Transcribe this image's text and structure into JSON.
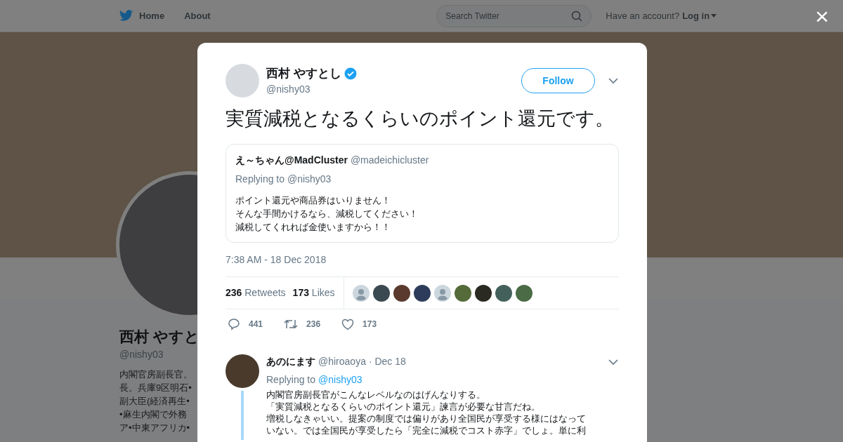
{
  "nav": {
    "links": [
      "Home",
      "About"
    ],
    "search": {
      "placeholder": "Search Twitter"
    },
    "account_prompt": "Have an account?",
    "login": "Log in",
    "close": "×"
  },
  "profile": {
    "name": "西村 やすと",
    "handle": "@nishy03",
    "bio_lines": [
      "内閣官房副長官。",
      "長。兵庫9区明石•",
      "副大臣(経済再生•",
      "•麻生内閣で外務",
      "ア•中東アフリカ•"
    ]
  },
  "tweet": {
    "author": {
      "name": "西村 やすとし",
      "handle": "@nishy03",
      "verified": true
    },
    "follow": "Follow",
    "text": "実質減税となるくらいのポイント還元です。",
    "quoted": {
      "name": "え～ちゃん@MadCluster",
      "handle": "@madeichicluster",
      "replying": "Replying to @nishy03",
      "lines": [
        "ポイント還元や商品券はいりません！",
        "そんな手間かけるなら、減税してください！",
        "減税してくれれば金使いますから！！"
      ]
    },
    "timestamp": "7:38 AM - 18 Dec 2018",
    "stats": [
      {
        "count": "236",
        "label": "Retweets"
      },
      {
        "count": "173",
        "label": "Likes"
      }
    ],
    "likers": [
      {
        "kind": "default"
      },
      {
        "kind": "photo"
      },
      {
        "kind": "photo"
      },
      {
        "kind": "photo"
      },
      {
        "kind": "default"
      },
      {
        "kind": "photo"
      },
      {
        "kind": "photo"
      },
      {
        "kind": "photo"
      },
      {
        "kind": "photo"
      }
    ],
    "actions": [
      {
        "kind": "reply",
        "count": "441"
      },
      {
        "kind": "retweet",
        "count": "236"
      },
      {
        "kind": "like",
        "count": "173"
      }
    ]
  },
  "reply": {
    "name": "あのにます",
    "handle": "@hiroaoya",
    "date": "· Dec 18",
    "replying_prefix": "Replying to",
    "replying_handle": "@nishy03",
    "lines": [
      "内閣官房副長官がこんなレベルなのはげんなりする。",
      "「実質減税となるくらいのポイント還元」諫言が必要な甘言だね。",
      "増税しなきゃいい。提案の制度では偏りがあり全国民が享受する様にはなって",
      "いない。では全国民が享受したら「完全に減税でコスト赤字」でしょ。単に利"
    ]
  }
}
